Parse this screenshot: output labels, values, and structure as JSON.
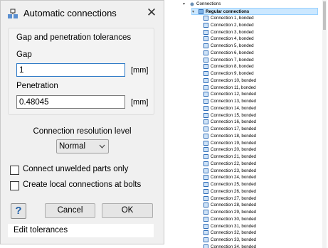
{
  "dialog": {
    "title": "Automatic connections",
    "close_glyph": "✕",
    "group": {
      "title": "Gap and penetration tolerances",
      "gap_label": "Gap",
      "gap_value": "1",
      "gap_unit": "[mm]",
      "penetration_label": "Penetration",
      "penetration_value": "0.48045",
      "penetration_unit": "[mm]"
    },
    "resolution_label": "Connection resolution level",
    "resolution_value": "Normal",
    "checkboxes": [
      {
        "label": "Connect unwelded parts only",
        "checked": false
      },
      {
        "label": "Create local connections at bolts",
        "checked": false
      }
    ],
    "help_glyph": "?",
    "cancel_label": "Cancel",
    "ok_label": "OK",
    "footer_text": "Edit tolerances"
  },
  "tree": {
    "root_label": "Connections",
    "group_label": "Regular connections",
    "items": [
      "Connection 1, bonded",
      "Connection 2, bonded",
      "Connection 3, bonded",
      "Connection 4, bonded",
      "Connection 5, bonded",
      "Connection 6, bonded",
      "Connection 7, bonded",
      "Connection 8, bonded",
      "Connection 9, bonded",
      "Connection 10, bonded",
      "Connection 11, bonded",
      "Connection 12, bonded",
      "Connection 13, bonded",
      "Connection 14, bonded",
      "Connection 15, bonded",
      "Connection 16, bonded",
      "Connection 17, bonded",
      "Connection 18, bonded",
      "Connection 19, bonded",
      "Connection 20, bonded",
      "Connection 21, bonded",
      "Connection 22, bonded",
      "Connection 23, bonded",
      "Connection 24, bonded",
      "Connection 25, bonded",
      "Connection 26, bonded",
      "Connection 27, bonded",
      "Connection 28, bonded",
      "Connection 29, bonded",
      "Connection 30, bonded",
      "Connection 31, bonded",
      "Connection 32, bonded",
      "Connection 33, bonded",
      "Connection 34, bonded"
    ]
  },
  "icons": {
    "app": "automatic-connections-icon",
    "close": "close-icon",
    "dropdown": "chevron-down-icon",
    "help": "help-icon",
    "tree_connection": "connection-icon"
  },
  "colors": {
    "dialog_bg": "#f0f0f0",
    "focus_border": "#2b78c6",
    "selection_bg": "#cce8ff",
    "help_blue": "#1f5fa8"
  }
}
